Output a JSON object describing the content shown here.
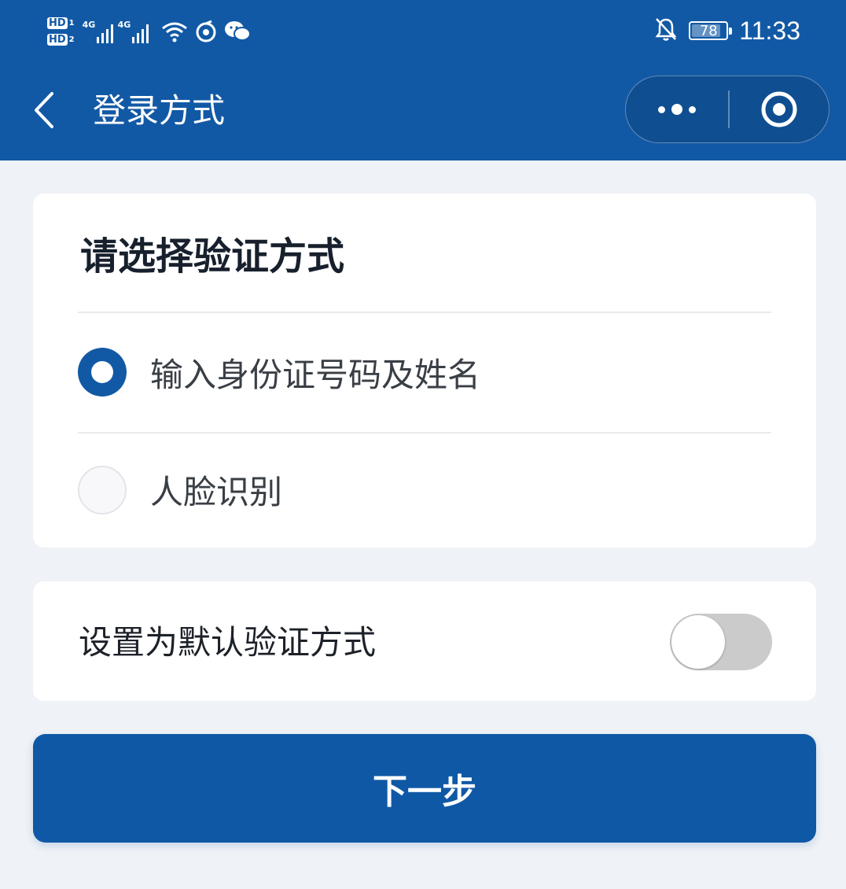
{
  "status_bar": {
    "sim1_label": "HD",
    "sim1_index": "1",
    "sim2_label": "HD",
    "sim2_index": "2",
    "network1": "4G",
    "network2": "4G",
    "battery_level": "78",
    "time": "11:33",
    "icons": [
      "signal-icon",
      "wifi-icon",
      "app-notification-icon",
      "wechat-icon",
      "mute-bell-icon",
      "battery-icon"
    ]
  },
  "navbar": {
    "title": "登录方式",
    "back_icon": "chevron-left-icon",
    "more_icon": "more-dots-icon",
    "close_icon": "target-close-icon"
  },
  "verify_card": {
    "heading": "请选择验证方式",
    "options": [
      {
        "label": "输入身份证号码及姓名",
        "selected": true
      },
      {
        "label": "人脸识别",
        "selected": false
      }
    ]
  },
  "default_card": {
    "label": "设置为默认验证方式",
    "toggle_on": false
  },
  "next_button": {
    "label": "下一步"
  },
  "colors": {
    "brand": "#1259a5",
    "background": "#eff2f6",
    "card": "#ffffff"
  }
}
